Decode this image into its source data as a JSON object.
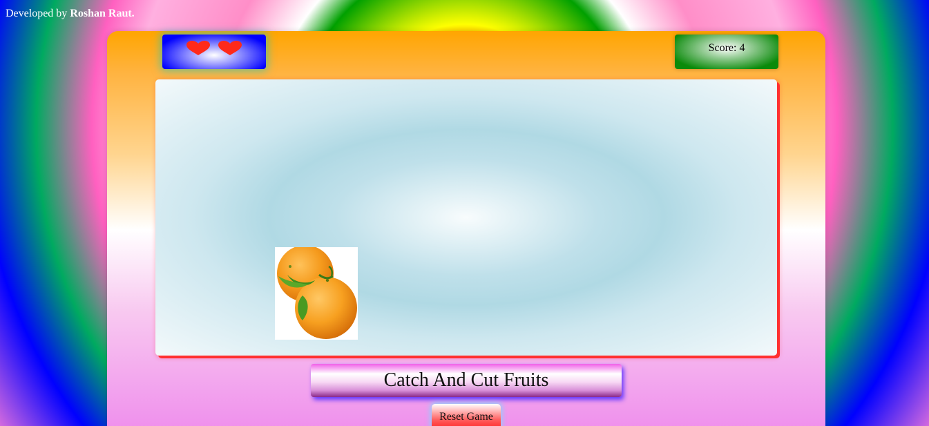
{
  "credit": {
    "prefix": "Developed by",
    "author": "Roshan Raut."
  },
  "lives": {
    "count": 2,
    "icon": "heart-icon",
    "color": "#ff2a1a"
  },
  "score": {
    "label": "Score:",
    "value": "4"
  },
  "play_area": {
    "fruit": {
      "name": "orange-icon"
    }
  },
  "title": "Catch And Cut Fruits",
  "reset_button": {
    "label": "Reset Game"
  }
}
